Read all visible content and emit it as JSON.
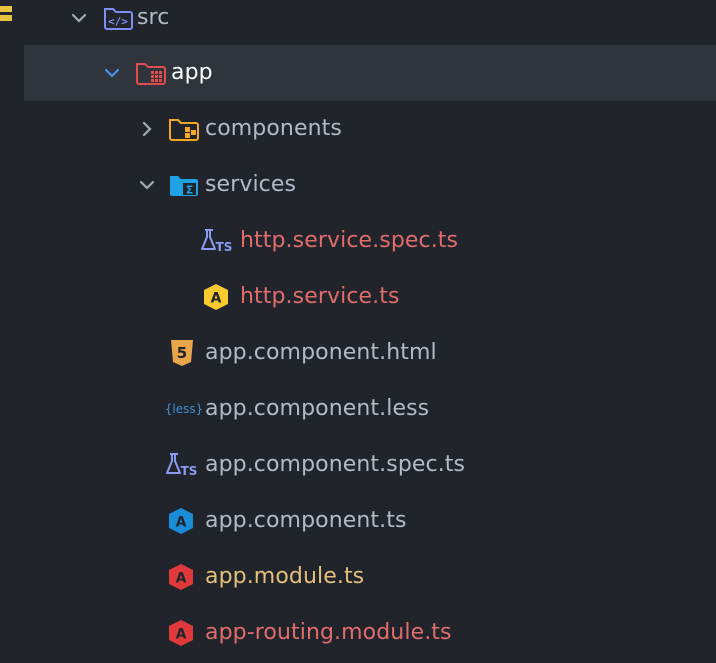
{
  "colors": {
    "background": "#21252b",
    "selected_row": "#2f343d",
    "text_default": "#b2bac8",
    "text_selected": "#ffffff",
    "text_modified": "#e06c6c",
    "text_changed": "#e5c07b",
    "chevron_default": "#a3aab7",
    "chevron_active": "#4e8fe8",
    "edge_marker": "#e8c341"
  },
  "tree": {
    "src": {
      "label": "src",
      "icon": "folder-src-icon",
      "expanded": true
    },
    "app": {
      "label": "app",
      "icon": "folder-app-icon",
      "expanded": true,
      "selected": true
    },
    "components": {
      "label": "components",
      "icon": "folder-components-icon",
      "expanded": false
    },
    "services": {
      "label": "services",
      "icon": "folder-services-icon",
      "expanded": true
    },
    "http_service_spec": {
      "label": "http.service.spec.ts",
      "icon": "test-ts-icon",
      "status": "modified"
    },
    "http_service": {
      "label": "http.service.ts",
      "icon": "angular-service-icon",
      "status": "modified"
    },
    "app_component_html": {
      "label": "app.component.html",
      "icon": "html5-icon"
    },
    "app_component_less": {
      "label": "app.component.less",
      "icon": "less-icon"
    },
    "app_component_spec": {
      "label": "app.component.spec.ts",
      "icon": "test-ts-icon"
    },
    "app_component_ts": {
      "label": "app.component.ts",
      "icon": "angular-component-icon"
    },
    "app_module": {
      "label": "app.module.ts",
      "icon": "angular-module-icon",
      "status": "changed"
    },
    "app_routing_module": {
      "label": "app-routing.module.ts",
      "icon": "angular-routing-icon",
      "status": "modified"
    }
  }
}
